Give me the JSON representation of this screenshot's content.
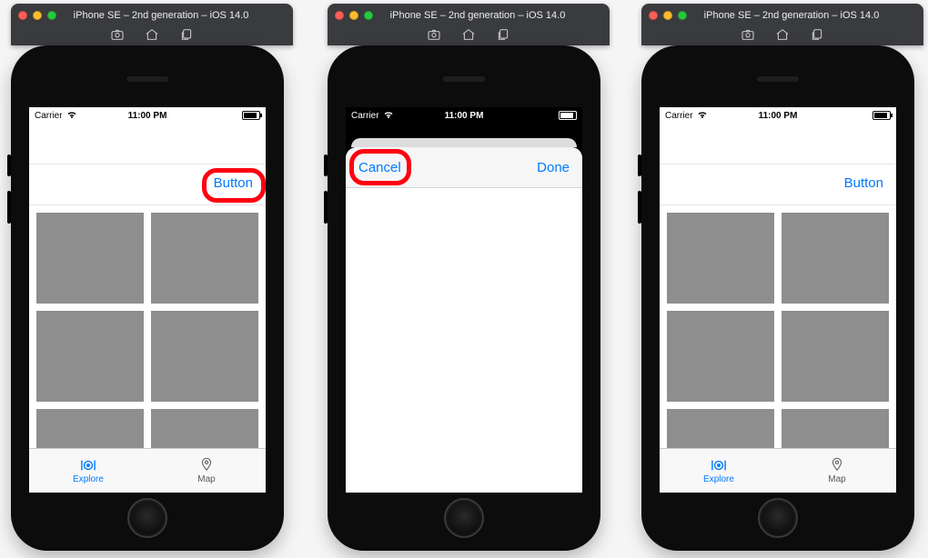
{
  "window_title": "iPhone SE – 2nd generation – iOS 14.0",
  "statusbar": {
    "carrier": "Carrier",
    "time": "11:00 PM"
  },
  "explore": {
    "button_label": "Button",
    "grid_tile_count": 6
  },
  "tabs": {
    "explore": "Explore",
    "map": "Map"
  },
  "modal": {
    "cancel": "Cancel",
    "done": "Done"
  },
  "toolbar_icons": {
    "screenshot": "screenshot-icon",
    "home": "home-icon",
    "switcher": "app-switcher-icon"
  }
}
